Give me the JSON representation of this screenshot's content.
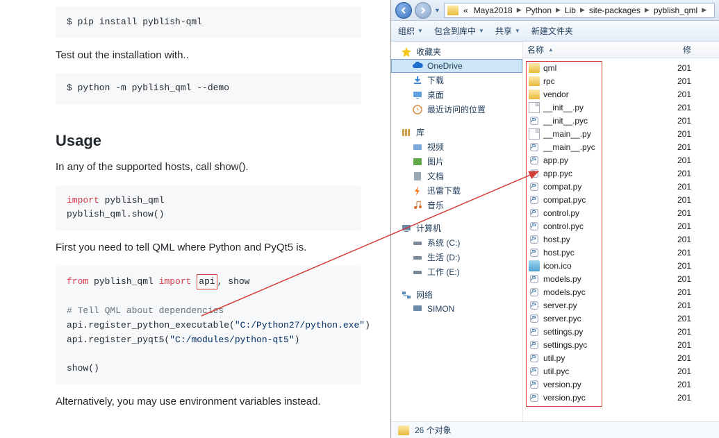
{
  "doc": {
    "install_cmd": "$ pip install pyblish-qml",
    "test_intro": "Test out the installation with..",
    "test_cmd": "$ python -m pyblish_qml --demo",
    "usage_heading": "Usage",
    "usage_intro": "In any of the supported hosts, call show().",
    "code1_import": "import",
    "code1_mod": " pyblish_qml",
    "code1_call": "pyblish_qml.show()",
    "tell_intro": "First you need to tell QML where Python and PyQt5 is.",
    "code2_from": "from",
    "code2_mod": " pyblish_qml ",
    "code2_import": "import",
    "code2_api": "api",
    "code2_rest": ", show",
    "code2_comment": "# Tell QML about dependencies",
    "code2_l3a": "api.register_python_executable(",
    "code2_l3s": "\"C:/Python27/python.exe\"",
    "code2_l3b": ")",
    "code2_l4a": "api.register_pyqt5(",
    "code2_l4s": "\"C:/modules/python-qt5\"",
    "code2_l4b": ")",
    "code2_show": "show()",
    "alt_intro": "Alternatively, you may use environment variables instead."
  },
  "explorer": {
    "breadcrumb": [
      "Maya2018",
      "Python",
      "Lib",
      "site-packages",
      "pyblish_qml"
    ],
    "toolbar": {
      "organize": "组织",
      "include": "包含到库中",
      "share": "共享",
      "newfolder": "新建文件夹"
    },
    "sidebar": {
      "favorites": "收藏夹",
      "onedrive": "OneDrive",
      "downloads": "下载",
      "desktop": "桌面",
      "recent": "最近访问的位置",
      "library": "库",
      "videos": "视频",
      "pictures": "图片",
      "documents": "文档",
      "xunlei": "迅雷下载",
      "music": "音乐",
      "computer": "计算机",
      "drive_c": "系统 (C:)",
      "drive_d": "生活 (D:)",
      "drive_e": "工作 (E:)",
      "network": "网络",
      "simon": "SIMON"
    },
    "columns": {
      "name": "名称",
      "date": "修"
    },
    "files": [
      {
        "name": "qml",
        "type": "folder",
        "date": "201"
      },
      {
        "name": "rpc",
        "type": "folder",
        "date": "201"
      },
      {
        "name": "vendor",
        "type": "folder",
        "date": "201"
      },
      {
        "name": "__init__.py",
        "type": "file",
        "date": "201"
      },
      {
        "name": "__init__.pyc",
        "type": "py",
        "date": "201"
      },
      {
        "name": "__main__.py",
        "type": "file",
        "date": "201"
      },
      {
        "name": "__main__.pyc",
        "type": "py",
        "date": "201"
      },
      {
        "name": "app.py",
        "type": "py",
        "date": "201"
      },
      {
        "name": "app.pyc",
        "type": "py",
        "date": "201"
      },
      {
        "name": "compat.py",
        "type": "py",
        "date": "201"
      },
      {
        "name": "compat.pyc",
        "type": "py",
        "date": "201"
      },
      {
        "name": "control.py",
        "type": "py",
        "date": "201"
      },
      {
        "name": "control.pyc",
        "type": "py",
        "date": "201"
      },
      {
        "name": "host.py",
        "type": "py",
        "date": "201"
      },
      {
        "name": "host.pyc",
        "type": "py",
        "date": "201"
      },
      {
        "name": "icon.ico",
        "type": "ico",
        "date": "201"
      },
      {
        "name": "models.py",
        "type": "py",
        "date": "201"
      },
      {
        "name": "models.pyc",
        "type": "py",
        "date": "201"
      },
      {
        "name": "server.py",
        "type": "py",
        "date": "201"
      },
      {
        "name": "server.pyc",
        "type": "py",
        "date": "201"
      },
      {
        "name": "settings.py",
        "type": "py",
        "date": "201"
      },
      {
        "name": "settings.pyc",
        "type": "py",
        "date": "201"
      },
      {
        "name": "util.py",
        "type": "py",
        "date": "201"
      },
      {
        "name": "util.pyc",
        "type": "py",
        "date": "201"
      },
      {
        "name": "version.py",
        "type": "py",
        "date": "201"
      },
      {
        "name": "version.pyc",
        "type": "py",
        "date": "201"
      }
    ],
    "status_count": "26 个对象"
  }
}
